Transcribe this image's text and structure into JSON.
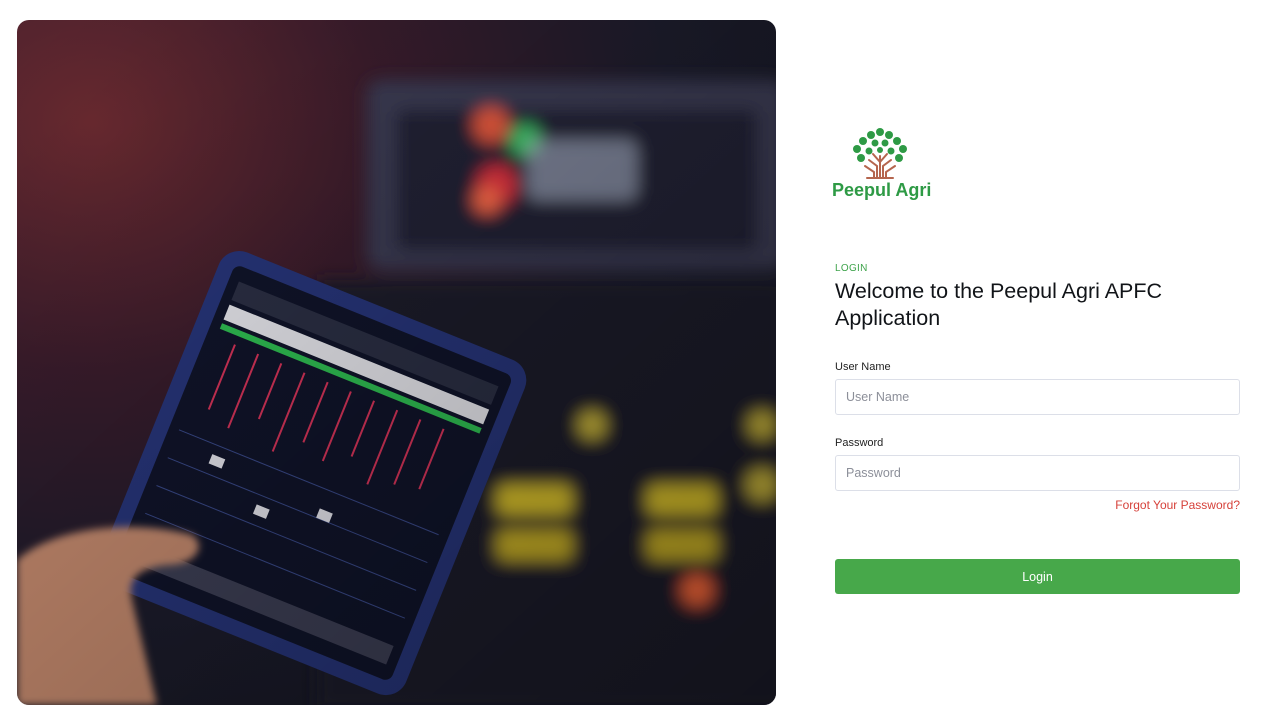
{
  "brand": {
    "name": "Peepul Agri",
    "colors": {
      "primary_green": "#47a84a",
      "logo_green": "#2e9a45",
      "logo_trunk": "#b5654e",
      "link_red": "#d6413a"
    }
  },
  "hero": {
    "image": "audio-mixing-tablet-photo"
  },
  "login": {
    "eyebrow": "LOGIN",
    "title": "Welcome to the Peepul Agri APFC Application",
    "username": {
      "label": "User Name",
      "placeholder": "User Name",
      "value": ""
    },
    "password": {
      "label": "Password",
      "placeholder": "Password",
      "value": ""
    },
    "forgot_link": "Forgot Your Password?",
    "submit_label": "Login"
  }
}
